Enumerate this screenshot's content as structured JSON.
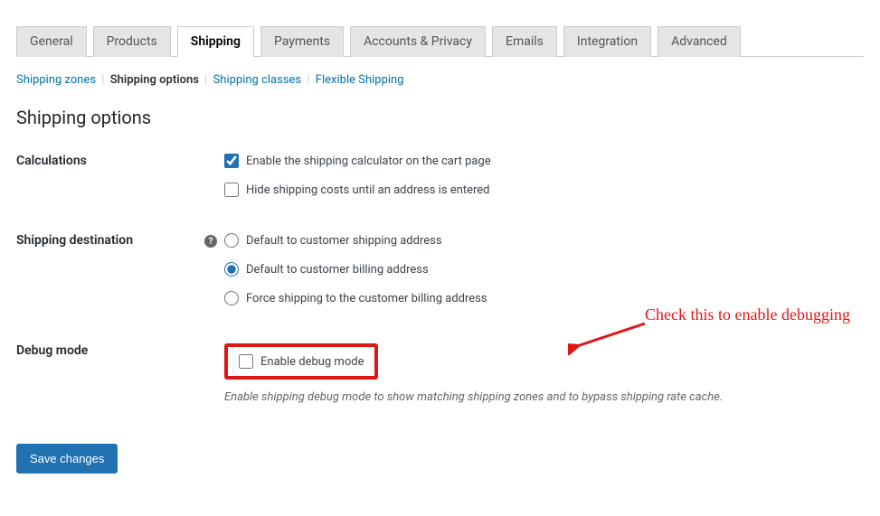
{
  "tabs": {
    "general": "General",
    "products": "Products",
    "shipping": "Shipping",
    "payments": "Payments",
    "accounts": "Accounts & Privacy",
    "emails": "Emails",
    "integration": "Integration",
    "advanced": "Advanced"
  },
  "subnav": {
    "zones": "Shipping zones",
    "options": "Shipping options",
    "classes": "Shipping classes",
    "flexible": "Flexible Shipping"
  },
  "heading": "Shipping options",
  "sections": {
    "calculations": {
      "label": "Calculations",
      "enable_calculator": "Enable the shipping calculator on the cart page",
      "hide_costs": "Hide shipping costs until an address is entered"
    },
    "destination": {
      "label": "Shipping destination",
      "default_shipping": "Default to customer shipping address",
      "default_billing": "Default to customer billing address",
      "force_billing": "Force shipping to the customer billing address"
    },
    "debug": {
      "label": "Debug mode",
      "enable_debug": "Enable debug mode",
      "description": "Enable shipping debug mode to show matching shipping zones and to bypass shipping rate cache."
    }
  },
  "annotation": "Check this to enable debugging",
  "save_button": "Save changes",
  "help_icon": "?"
}
